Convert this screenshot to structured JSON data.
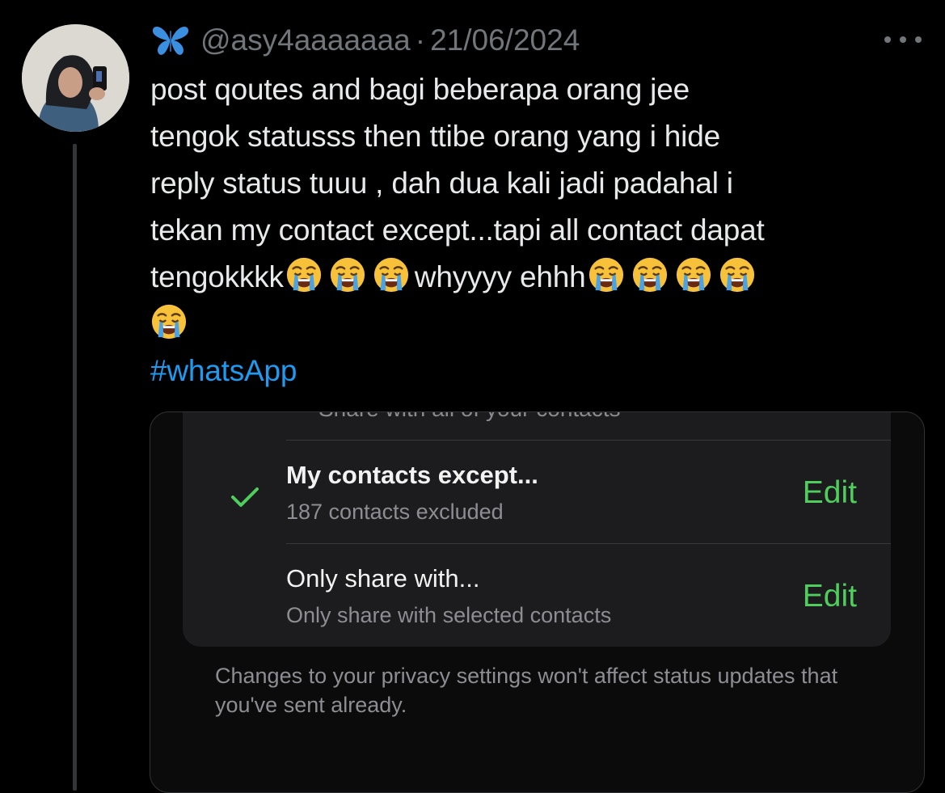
{
  "tweet": {
    "author_handle": "@asy4aaaaaaa",
    "separator": "·",
    "date": "21/06/2024",
    "text_lines": [
      "post qoutes and bagi beberapa orang jee",
      "tengok statusss then ttibe orang yang i hide",
      "reply status tuuu , dah dua kali jadi padahal i",
      "tekan my contact except...tapi all contact dapat"
    ],
    "line5_start": "tengokkkk",
    "line5_middle": "whyyyy ehhh",
    "hashtag": "#whatsApp"
  },
  "icons": {
    "badge": "butterfly-icon",
    "more": "more-icon",
    "emoji": "loudly-crying-face-emoji",
    "check": "checkmark-icon"
  },
  "screenshot": {
    "cutoff_text": "Share with all of your contacts",
    "option1": {
      "title": "My contacts except...",
      "subtitle": "187 contacts excluded",
      "action": "Edit",
      "selected": true
    },
    "option2": {
      "title": "Only share with...",
      "subtitle": "Only share with selected contacts",
      "action": "Edit",
      "selected": false
    },
    "footer_note": "Changes to your privacy settings won't affect status updates that you've sent already."
  },
  "colors": {
    "background": "#000000",
    "hashtag": "#1d9bf0",
    "whatsapp_green": "#4fce5d"
  }
}
